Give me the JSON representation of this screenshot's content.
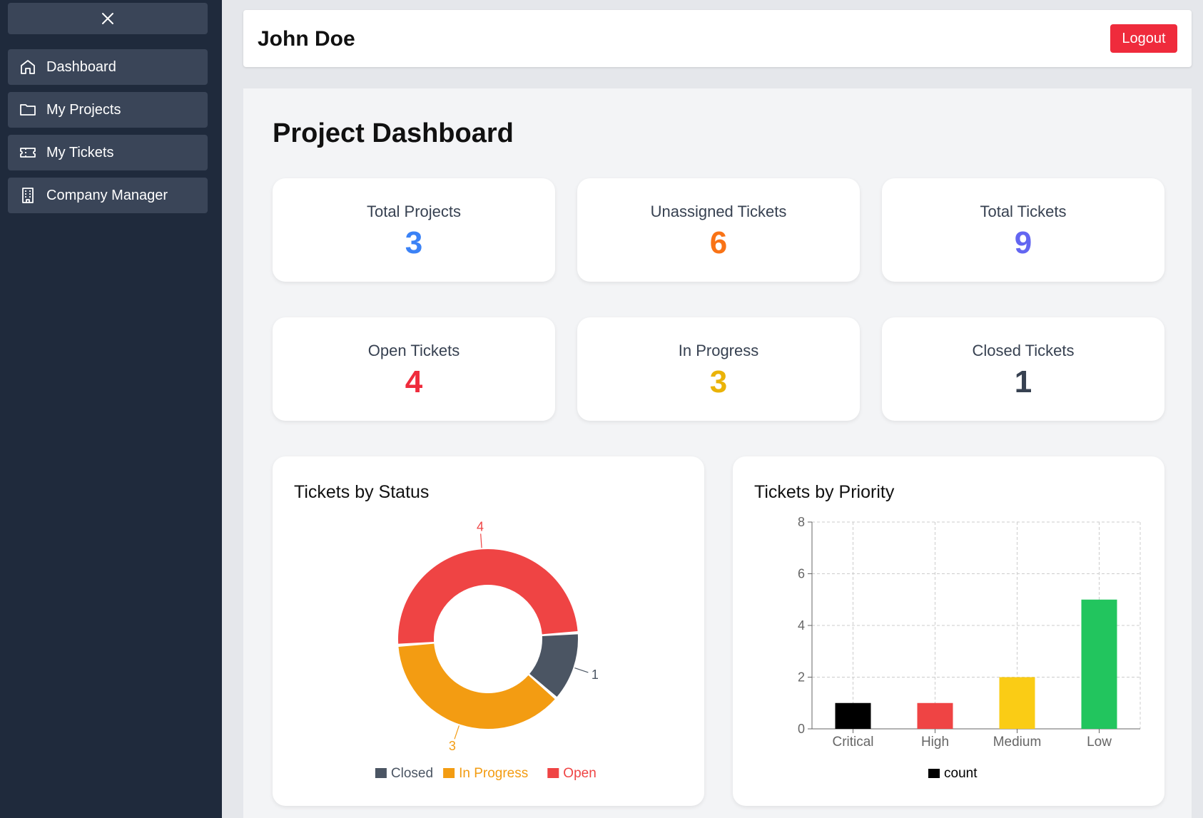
{
  "sidebar": {
    "close_icon": "close-icon",
    "items": [
      {
        "label": "Dashboard",
        "icon": "home-icon"
      },
      {
        "label": "My Projects",
        "icon": "folder-icon"
      },
      {
        "label": "My Tickets",
        "icon": "ticket-icon"
      },
      {
        "label": "Company Manager",
        "icon": "building-icon"
      }
    ]
  },
  "header": {
    "user_name": "John Doe",
    "logout_label": "Logout"
  },
  "main": {
    "title": "Project Dashboard",
    "stats": [
      {
        "label": "Total Projects",
        "value": "3",
        "color": "#3b82f6"
      },
      {
        "label": "Unassigned Tickets",
        "value": "6",
        "color": "#f97316"
      },
      {
        "label": "Total Tickets",
        "value": "9",
        "color": "#6366f1"
      },
      {
        "label": "Open Tickets",
        "value": "4",
        "color": "#ef2b3c"
      },
      {
        "label": "In Progress",
        "value": "3",
        "color": "#eab308"
      },
      {
        "label": "Closed Tickets",
        "value": "1",
        "color": "#374151"
      }
    ]
  },
  "chart_data": [
    {
      "type": "pie",
      "title": "Tickets by Status",
      "categories": [
        "Closed",
        "In Progress",
        "Open"
      ],
      "values": [
        1,
        3,
        4
      ],
      "colors": [
        "#4b5563",
        "#f39c12",
        "#ef4444"
      ],
      "legend": "bottom"
    },
    {
      "type": "bar",
      "title": "Tickets by Priority",
      "categories": [
        "Critical",
        "High",
        "Medium",
        "Low"
      ],
      "series": [
        {
          "name": "count",
          "values": [
            1,
            1,
            2,
            5
          ]
        }
      ],
      "colors": [
        "#000000",
        "#ef4444",
        "#facc15",
        "#22c55e"
      ],
      "yticks": [
        0,
        2,
        4,
        6,
        8
      ],
      "ylim": [
        0,
        8
      ],
      "grid": true,
      "legend": "bottom"
    }
  ]
}
